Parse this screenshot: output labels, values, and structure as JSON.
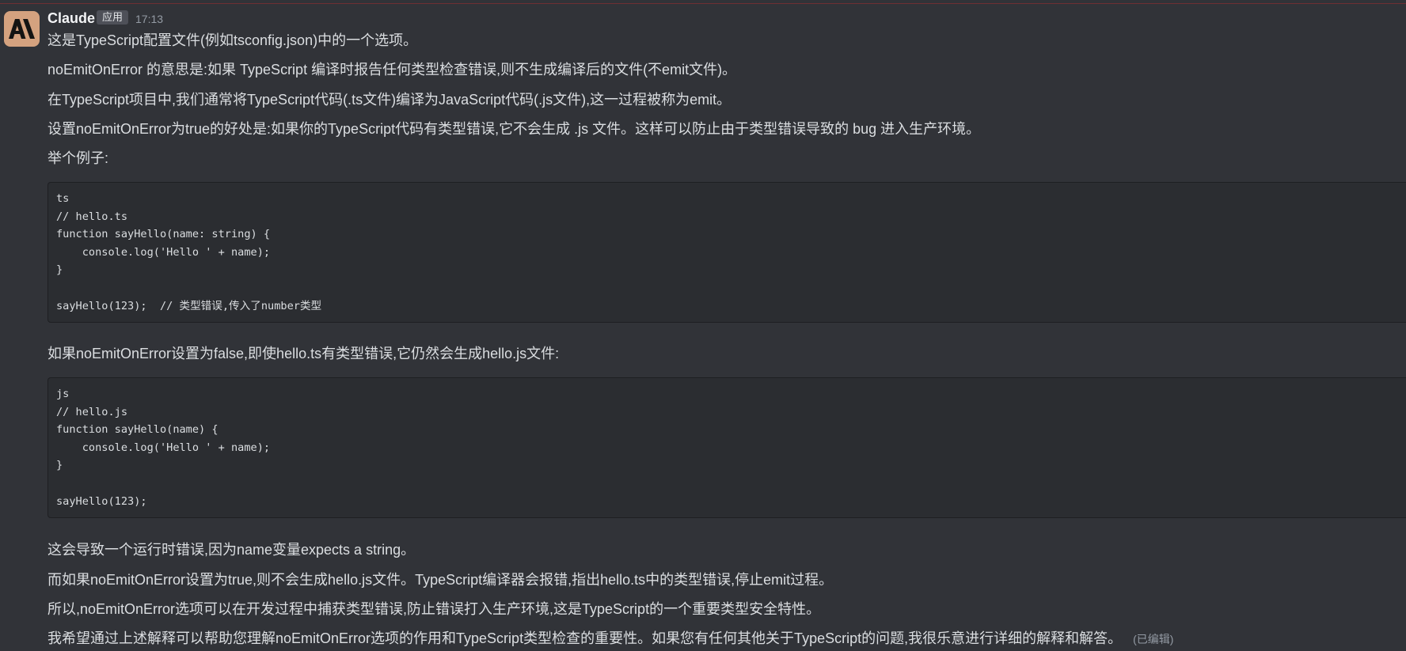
{
  "colors": {
    "background": "#313338",
    "text": "#dbdee1",
    "code_background": "#2b2d31",
    "avatar_background": "#d4a27f",
    "badge_background": "#4e5058",
    "divider": "#6e2f33"
  },
  "message": {
    "avatar_icon": "claude-logo-icon",
    "author": "Claude",
    "badge": "应用",
    "timestamp": "17:13",
    "intro": [
      "这是TypeScript配置文件(例如tsconfig.json)中的一个选项。",
      "noEmitOnError 的意思是:如果 TypeScript 编译时报告任何类型检查错误,则不生成编译后的文件(不emit文件)。",
      "在TypeScript项目中,我们通常将TypeScript代码(.ts文件)编译为JavaScript代码(.js文件),这一过程被称为emit。",
      "设置noEmitOnError为true的好处是:如果你的TypeScript代码有类型错误,它不会生成 .js 文件。这样可以防止由于类型错误导致的 bug 进入生产环境。",
      "举个例子:"
    ],
    "code_blocks": [
      {
        "lines": [
          "ts",
          "// hello.ts",
          "function sayHello(name: string) {",
          "    console.log('Hello ' + name);",
          "}",
          "",
          "sayHello(123);  // 类型错误,传入了number类型"
        ]
      },
      {
        "lines": [
          "js",
          "// hello.js",
          "function sayHello(name) {",
          "    console.log('Hello ' + name);",
          "}",
          "",
          "sayHello(123);"
        ]
      }
    ],
    "between": "如果noEmitOnError设置为false,即使hello.ts有类型错误,它仍然会生成hello.js文件:",
    "outro": [
      "这会导致一个运行时错误,因为name变量expects a string。",
      "而如果noEmitOnError设置为true,则不会生成hello.js文件。TypeScript编译器会报错,指出hello.ts中的类型错误,停止emit过程。",
      "所以,noEmitOnError选项可以在开发过程中捕获类型错误,防止错误打入生产环境,这是TypeScript的一个重要类型安全特性。",
      "我希望通过上述解释可以帮助您理解noEmitOnError选项的作用和TypeScript类型检查的重要性。如果您有任何其他关于TypeScript的问题,我很乐意进行详细的解释和解答。"
    ],
    "edited_label": "(已编辑)"
  }
}
